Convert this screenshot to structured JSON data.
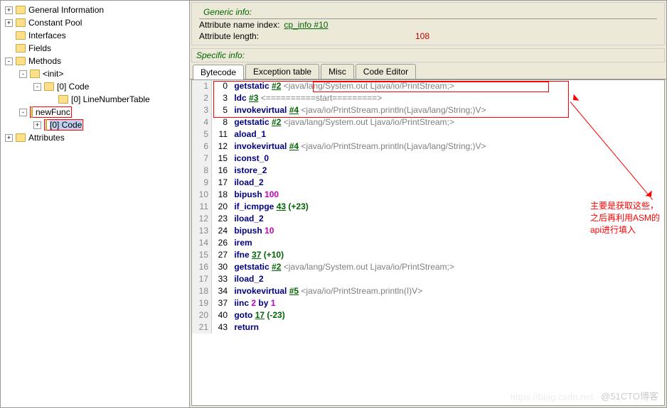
{
  "tree": {
    "items": [
      {
        "indent": 0,
        "exp": "+",
        "label": "General Information"
      },
      {
        "indent": 0,
        "exp": "+",
        "label": "Constant Pool"
      },
      {
        "indent": 0,
        "exp": "",
        "label": "Interfaces"
      },
      {
        "indent": 0,
        "exp": "",
        "label": "Fields"
      },
      {
        "indent": 0,
        "exp": "-",
        "label": "Methods"
      },
      {
        "indent": 1,
        "exp": "-",
        "label": "<init>"
      },
      {
        "indent": 2,
        "exp": "-",
        "label": "[0] Code"
      },
      {
        "indent": 3,
        "exp": "",
        "label": "[0] LineNumberTable"
      },
      {
        "indent": 1,
        "exp": "-",
        "label": "newFunc",
        "boxed": true
      },
      {
        "indent": 2,
        "exp": "+",
        "label": "[0] Code",
        "sel": true,
        "boxed": true
      },
      {
        "indent": 0,
        "exp": "+",
        "label": "Attributes"
      }
    ]
  },
  "generic": {
    "title": "Generic info:",
    "rows": [
      {
        "k": "Attribute name index:",
        "link": "cp_info #10"
      },
      {
        "k": "Attribute length:",
        "num": "108"
      }
    ]
  },
  "specific": {
    "title": "Specific info:"
  },
  "tabs": [
    "Bytecode",
    "Exception table",
    "Misc",
    "Code Editor"
  ],
  "activeTab": 0,
  "bytecode": [
    {
      "ln": 1,
      "off": 0,
      "op": "getstatic",
      "ref": "#2",
      "cmt": "<java/lang/System.out Ljava/io/PrintStream;>"
    },
    {
      "ln": 2,
      "off": 3,
      "op": "ldc",
      "ref": "#3",
      "cmt": "<==========start=========>"
    },
    {
      "ln": 3,
      "off": 5,
      "op": "invokevirtual",
      "ref": "#4",
      "cmt": "<java/io/PrintStream.println(Ljava/lang/String;)V>"
    },
    {
      "ln": 4,
      "off": 8,
      "op": "getstatic",
      "ref": "#2",
      "cmt": "<java/lang/System.out Ljava/io/PrintStream;>"
    },
    {
      "ln": 5,
      "off": 11,
      "op": "aload_1"
    },
    {
      "ln": 6,
      "off": 12,
      "op": "invokevirtual",
      "ref": "#4",
      "cmt": "<java/io/PrintStream.println(Ljava/lang/String;)V>"
    },
    {
      "ln": 7,
      "off": 15,
      "op": "iconst_0"
    },
    {
      "ln": 8,
      "off": 16,
      "op": "istore_2"
    },
    {
      "ln": 9,
      "off": 17,
      "op": "iload_2"
    },
    {
      "ln": 10,
      "off": 18,
      "op": "bipush",
      "num": "100"
    },
    {
      "ln": 11,
      "off": 20,
      "op": "if_icmpge",
      "jump": "43 (+23)"
    },
    {
      "ln": 12,
      "off": 23,
      "op": "iload_2"
    },
    {
      "ln": 13,
      "off": 24,
      "op": "bipush",
      "num": "10"
    },
    {
      "ln": 14,
      "off": 26,
      "op": "irem"
    },
    {
      "ln": 15,
      "off": 27,
      "op": "ifne",
      "jump": "37 (+10)"
    },
    {
      "ln": 16,
      "off": 30,
      "op": "getstatic",
      "ref": "#2",
      "cmt": "<java/lang/System.out Ljava/io/PrintStream;>"
    },
    {
      "ln": 17,
      "off": 33,
      "op": "iload_2"
    },
    {
      "ln": 18,
      "off": 34,
      "op": "invokevirtual",
      "ref": "#5",
      "cmt": "<java/io/PrintStream.println(I)V>"
    },
    {
      "ln": 19,
      "off": 37,
      "op": "iinc",
      "iinc": "2 by 1"
    },
    {
      "ln": 20,
      "off": 40,
      "op": "goto",
      "jump": "17 (-23)"
    },
    {
      "ln": 21,
      "off": 43,
      "op": "return"
    }
  ],
  "annotation": {
    "l1": "主要是获取这些，",
    "l2": "之后再利用ASM的api进行填入"
  },
  "watermark": "@51CTO博客",
  "watermark2": "https://blog.csdn.net"
}
